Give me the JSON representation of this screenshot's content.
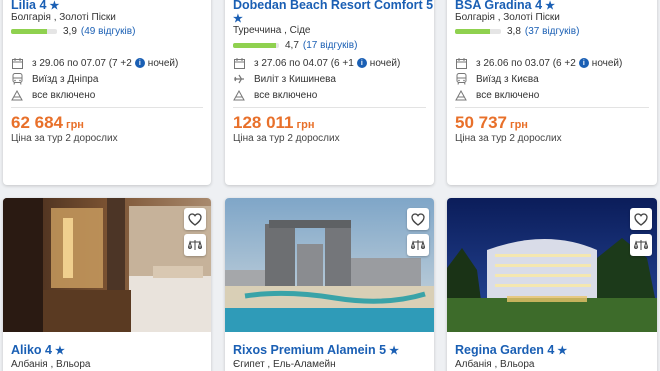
{
  "top_cards": [
    {
      "name": "Lilia 4",
      "location": "Болгарія , Золоті Піски",
      "rating": "3,9",
      "rating_fraction": 0.78,
      "reviews": "(49 відгуків)",
      "dates_prefix": "з 29.06 по 07.07 (7 +2",
      "dates_suffix": "ночей)",
      "departure": "Виїзд з Дніпра",
      "departure_icon": "bus-icon",
      "meal": "все включено",
      "price": "62 684",
      "currency": "грн",
      "price_note": "Ціна за тур 2 дорослих"
    },
    {
      "name": "Dobedan Beach Resort Comfort 5",
      "location": "Туреччина , Сіде",
      "rating": "4,7",
      "rating_fraction": 0.94,
      "reviews": "(17 відгуків)",
      "dates_prefix": "з 27.06 по 04.07 (6 +1",
      "dates_suffix": "ночей)",
      "departure": "Виліт з Кишинева",
      "departure_icon": "plane-icon",
      "meal": "все включено",
      "price": "128 011",
      "currency": "грн",
      "price_note": "Ціна за тур 2 дорослих"
    },
    {
      "name": "BSA Gradina 4",
      "location": "Болгарія , Золоті Піски",
      "rating": "3,8",
      "rating_fraction": 0.76,
      "reviews": "(37 відгуків)",
      "dates_prefix": "з 26.06 по 03.07 (6 +2",
      "dates_suffix": "ночей)",
      "departure": "Виїзд з Києва",
      "departure_icon": "bus-icon",
      "meal": "все включено",
      "price": "50 737",
      "currency": "грн",
      "price_note": "Ціна за тур 2 дорослих"
    }
  ],
  "bottom_cards": [
    {
      "name": "Aliko 4",
      "location": "Албанія , Вльора",
      "photo": "hotel-room-photo"
    },
    {
      "name": "Rixos Premium Alamein 5",
      "location": "Єгипет , Ель-Аламейн",
      "photo": "resort-tower-photo"
    },
    {
      "name": "Regina Garden 4",
      "location": "Албанія , Вльора",
      "photo": "night-hotel-photo"
    }
  ],
  "info_badge": "i",
  "star_symbol": "★",
  "colors": {
    "link": "#1a5fb4",
    "price": "#e8702a",
    "rating_bar": "#8fd14f"
  }
}
